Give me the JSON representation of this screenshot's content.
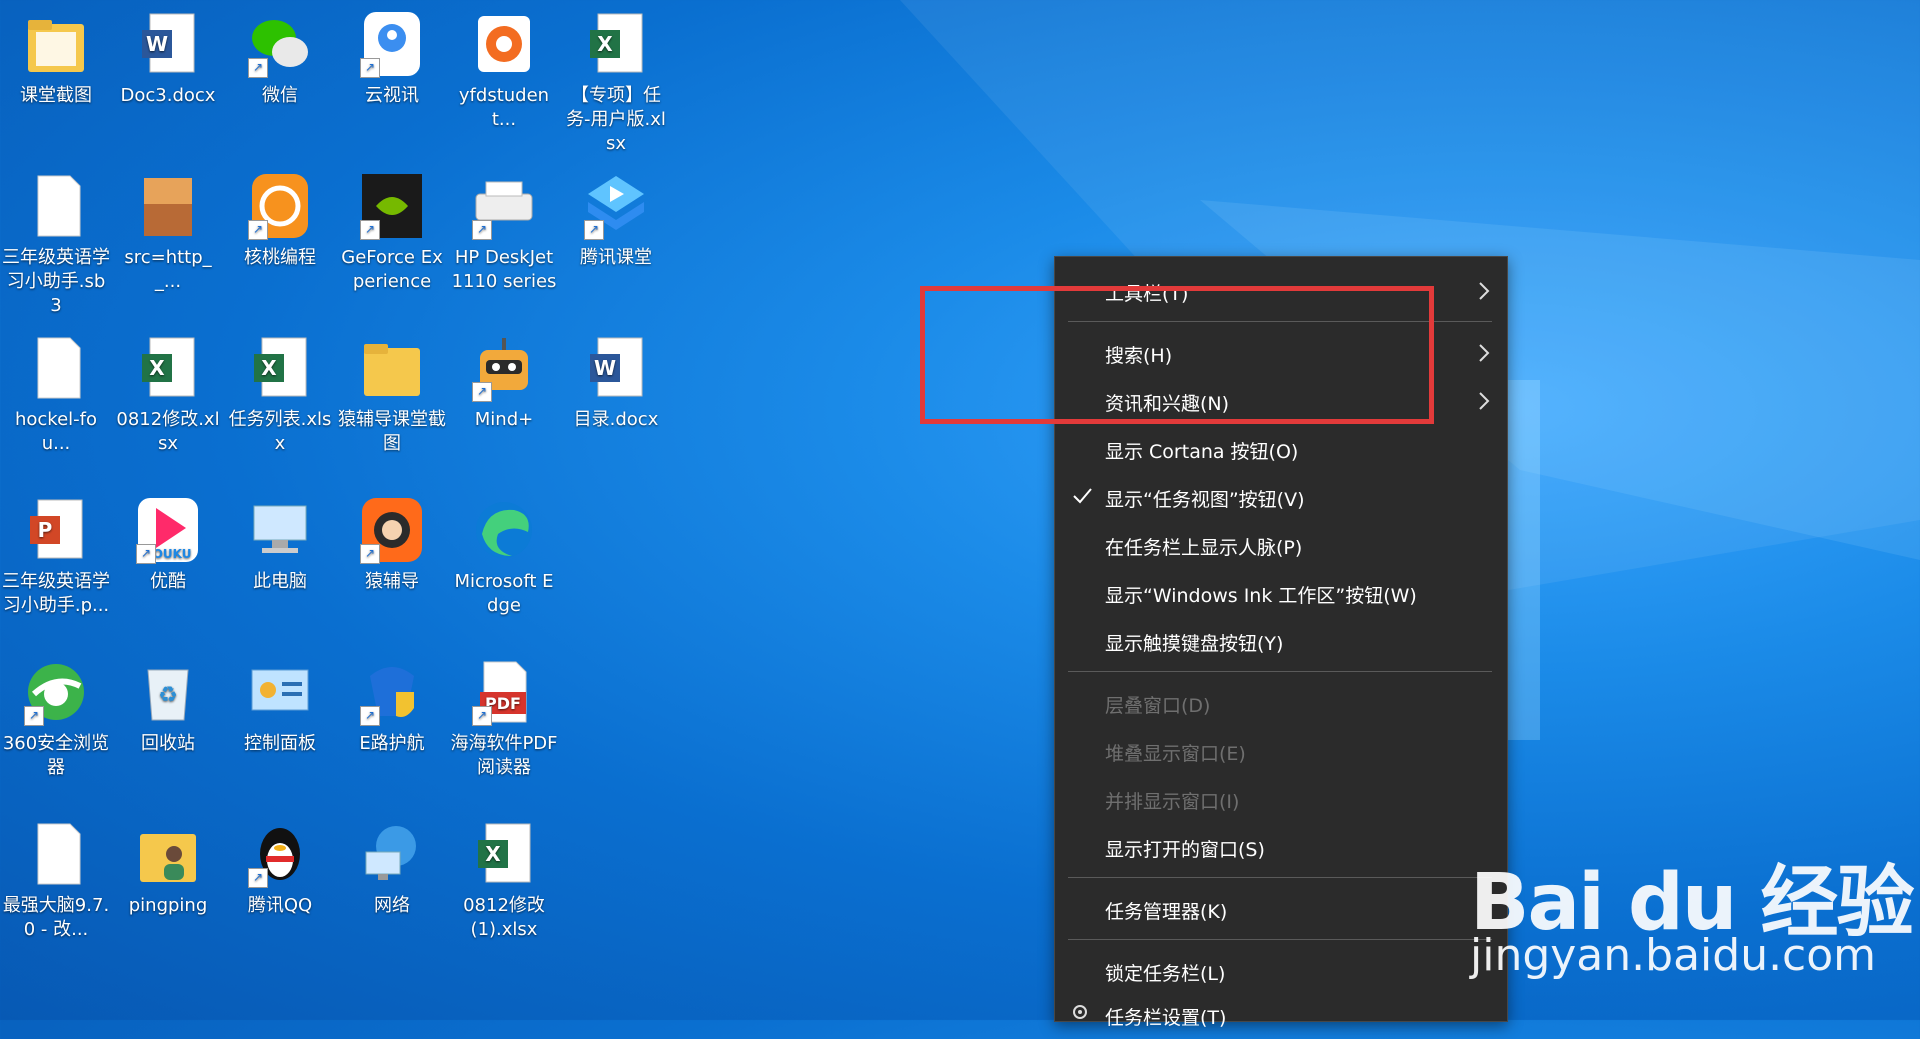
{
  "desktop": {
    "icons": [
      {
        "label": "课堂截图",
        "icon": "folder-icon"
      },
      {
        "label": "Doc3.docx",
        "icon": "word-document-icon"
      },
      {
        "label": "微信",
        "icon": "wechat-icon"
      },
      {
        "label": "云视讯",
        "icon": "cloud-video-icon"
      },
      {
        "label": "yfdstudent...",
        "icon": "installer-icon"
      },
      {
        "label": "【专项】任务-用户版.xlsx",
        "icon": "excel-document-icon"
      },
      {
        "label": "三年级英语学习小助手.sb3",
        "icon": "blank-file-icon"
      },
      {
        "label": "src=http__...",
        "icon": "image-file-icon"
      },
      {
        "label": "核桃编程",
        "icon": "walnut-coding-icon"
      },
      {
        "label": "GeForce Experience",
        "icon": "geforce-icon"
      },
      {
        "label": "HP DeskJet 1110 series",
        "icon": "printer-icon"
      },
      {
        "label": "腾讯课堂",
        "icon": "tencent-classroom-icon"
      },
      {
        "label": "hockel-fou...",
        "icon": "blank-file-icon"
      },
      {
        "label": "0812修改.xlsx",
        "icon": "excel-document-icon"
      },
      {
        "label": "任务列表.xlsx",
        "icon": "excel-document-icon"
      },
      {
        "label": "猿辅导课堂截图",
        "icon": "folder-icon"
      },
      {
        "label": "Mind+",
        "icon": "mind-plus-robot-icon"
      },
      {
        "label": "目录.docx",
        "icon": "word-document-icon"
      },
      {
        "label": "三年级英语学习小助手.p...",
        "icon": "powerpoint-icon"
      },
      {
        "label": "优酷",
        "icon": "youku-icon"
      },
      {
        "label": "此电脑",
        "icon": "computer-icon"
      },
      {
        "label": "猿辅导",
        "icon": "yuanfudao-icon"
      },
      {
        "label": "Microsoft Edge",
        "icon": "edge-icon"
      },
      {
        "label": "",
        "icon": ""
      },
      {
        "label": "360安全浏览器",
        "icon": "360-browser-icon"
      },
      {
        "label": "回收站",
        "icon": "recycle-bin-icon"
      },
      {
        "label": "控制面板",
        "icon": "control-panel-icon"
      },
      {
        "label": "E路护航",
        "icon": "shield-icon"
      },
      {
        "label": "海海软件PDF阅读器",
        "icon": "pdf-reader-icon"
      },
      {
        "label": "",
        "icon": ""
      },
      {
        "label": "最强大脑9.7.0 - 改...",
        "icon": "blank-file-icon"
      },
      {
        "label": "pingping",
        "icon": "user-folder-icon"
      },
      {
        "label": "腾讯QQ",
        "icon": "qq-penguin-icon"
      },
      {
        "label": "网络",
        "icon": "network-icon"
      },
      {
        "label": "0812修改(1).xlsx",
        "icon": "excel-document-icon"
      }
    ]
  },
  "context_menu": {
    "items": [
      {
        "label": "工具栏(T)",
        "submenu": true,
        "disabled": false
      },
      {
        "label": "搜索(H)",
        "submenu": true,
        "disabled": false
      },
      {
        "label": "资讯和兴趣(N)",
        "submenu": true,
        "disabled": false
      },
      {
        "label": "显示 Cortana 按钮(O)",
        "submenu": false,
        "disabled": false
      },
      {
        "label": "显示“任务视图”按钮(V)",
        "submenu": false,
        "disabled": false,
        "checked": true
      },
      {
        "label": "在任务栏上显示人脉(P)",
        "submenu": false,
        "disabled": false
      },
      {
        "label": "显示“Windows Ink 工作区”按钮(W)",
        "submenu": false,
        "disabled": false
      },
      {
        "label": "显示触摸键盘按钮(Y)",
        "submenu": false,
        "disabled": false
      },
      {
        "label": "层叠窗口(D)",
        "submenu": false,
        "disabled": true
      },
      {
        "label": "堆叠显示窗口(E)",
        "submenu": false,
        "disabled": true
      },
      {
        "label": "并排显示窗口(I)",
        "submenu": false,
        "disabled": true
      },
      {
        "label": "显示打开的窗口(S)",
        "submenu": false,
        "disabled": false
      },
      {
        "label": "任务管理器(K)",
        "submenu": false,
        "disabled": false
      },
      {
        "label": "锁定任务栏(L)",
        "submenu": false,
        "disabled": false
      },
      {
        "label": "任务栏设置(T)",
        "submenu": false,
        "disabled": false,
        "icon": "gear-icon"
      }
    ]
  },
  "watermark": {
    "logo": "Bai du 经验",
    "url": "jingyan.baidu.com"
  },
  "colors": {
    "menu_bg": "#2b2b2b",
    "highlight_border": "#e23a3a",
    "desktop_blue": "#0a6fd0"
  }
}
